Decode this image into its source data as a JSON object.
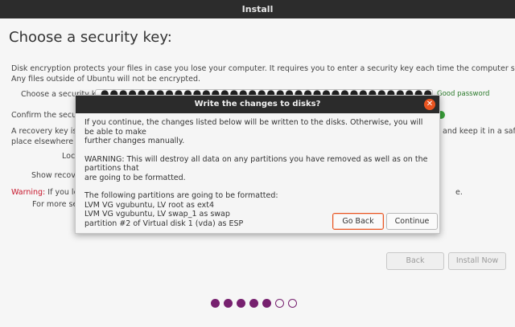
{
  "window": {
    "title": "Install"
  },
  "page": {
    "title": "Choose a security key:",
    "description_line1": "Disk encryption protects your files in case you lose your computer. It requires you to enter a security key each time the computer starts up.",
    "description_line2": "Any files outside of Ubuntu will not be encrypted.",
    "key_label": "Choose a security key:",
    "key_value": "●●●●●●●●●●●●●●●●●●●●●●●●●●●●●●●●●●●●●●●●●●●●●●●●●●●●●●●●●●●●",
    "strength": "Good password",
    "confirm_label": "Confirm the security key:",
    "recovery_text_a": "A recovery key is generated",
    "recovery_text_b": "and keep it in a safe",
    "recovery_text_c": "place elsewhere be",
    "location_label": "Loc",
    "show_recovery_label": "Show recove",
    "warning_word": "Warning:",
    "warning_text": " If you lose",
    "warning_tail": "e.",
    "more_info": "For more sec",
    "back_label": "Back",
    "install_label": "Install Now"
  },
  "progress": {
    "total": 7,
    "completed": 5
  },
  "dialog": {
    "title": "Write the changes to disks?",
    "paragraph1": "If you continue, the changes listed below will be written to the disks. Otherwise, you will be able to make\nfurther changes manually.",
    "paragraph2": "WARNING: This will destroy all data on any partitions you have removed as well as on the partitions that\nare going to be formatted.",
    "partitions_heading": "The following partitions are going to be formatted:",
    "partitions": [
      " LVM VG vgubuntu, LV root as ext4",
      " LVM VG vgubuntu, LV swap_1 as swap",
      " partition #2 of Virtual disk 1 (vda) as ESP"
    ],
    "go_back_label": "Go Back",
    "continue_label": "Continue"
  }
}
